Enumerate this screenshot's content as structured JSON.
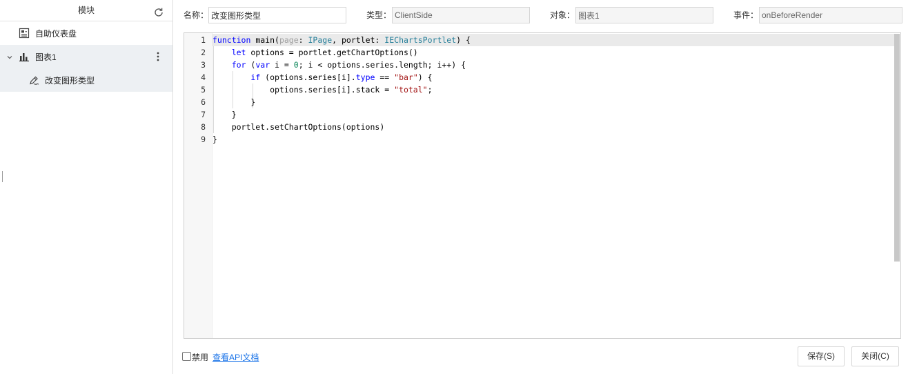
{
  "left_panel": {
    "title": "模块",
    "items": [
      {
        "label": "自助仪表盘",
        "icon": "dashboard-icon"
      },
      {
        "label": "图表1",
        "icon": "bar-chart-icon",
        "expanded": true
      },
      {
        "label": "改变图形类型",
        "icon": "script-edit-icon",
        "selected": true
      }
    ]
  },
  "form": {
    "name_label": "名称：",
    "name_value": "改变图形类型",
    "type_label": "类型：",
    "type_value": "ClientSide",
    "object_label": "对象：",
    "object_value": "图表1",
    "event_label": "事件：",
    "event_value": "onBeforeRender"
  },
  "editor": {
    "line_numbers": [
      "1",
      "2",
      "3",
      "4",
      "5",
      "6",
      "7",
      "8",
      "9"
    ]
  },
  "footer": {
    "disable_label": "禁用",
    "api_link": "查看API文档",
    "save_button": "保存(S)",
    "close_button": "关闭(C)"
  },
  "colors": {
    "accent_link": "#1a73e8",
    "keyword": "#0000ff",
    "type": "#267f99",
    "string": "#a31515",
    "number": "#098658"
  }
}
